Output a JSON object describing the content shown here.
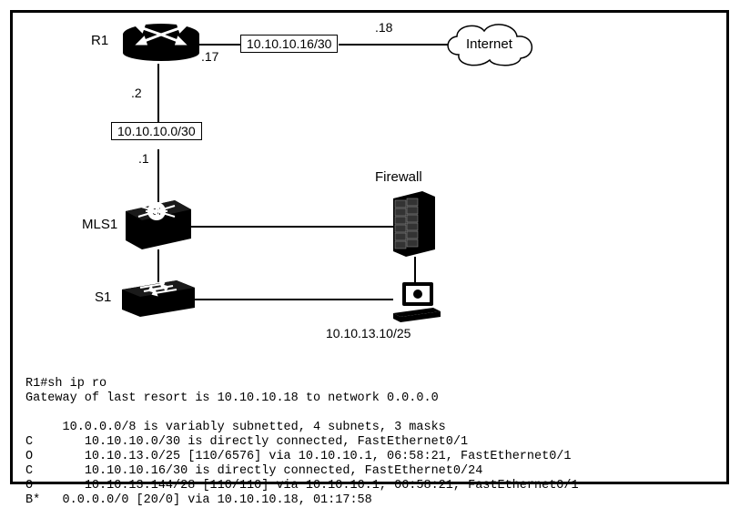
{
  "devices": {
    "r1": "R1",
    "mls1": "MLS1",
    "s1": "S1",
    "firewall": "Firewall",
    "internet": "Internet"
  },
  "nets": {
    "r1_internet": "10.10.10.16/30",
    "r1_mls1": "10.10.10.0/30"
  },
  "hosts": {
    "r1_up": ".17",
    "r1_down": ".2",
    "mls1_up": ".1",
    "internet_side": ".18",
    "pc": "10.10.13.10/25"
  },
  "cli": {
    "prompt": "R1#sh ip ro",
    "gw": "Gateway of last resort is 10.10.10.18 to network 0.0.0.0",
    "blank1": "",
    "summary": "     10.0.0.0/8 is variably subnetted, 4 subnets, 3 masks",
    "l1code": "C",
    "l1": "       10.10.10.0/30 is directly connected, FastEthernet0/1",
    "l2code": "O",
    "l2": "       10.10.13.0/25 [110/6576] via 10.10.10.1, 06:58:21, FastEthernet0/1",
    "l3code": "C",
    "l3": "       10.10.10.16/30 is directly connected, FastEthernet0/24",
    "l4code": "O",
    "l4": "       10.10.13.144/28 [110/110] via 10.10.10.1, 06:58:21, FastEthernet0/1",
    "l5code": "B*",
    "l5": "   0.0.0.0/0 [20/0] via 10.10.10.18, 01:17:58"
  }
}
